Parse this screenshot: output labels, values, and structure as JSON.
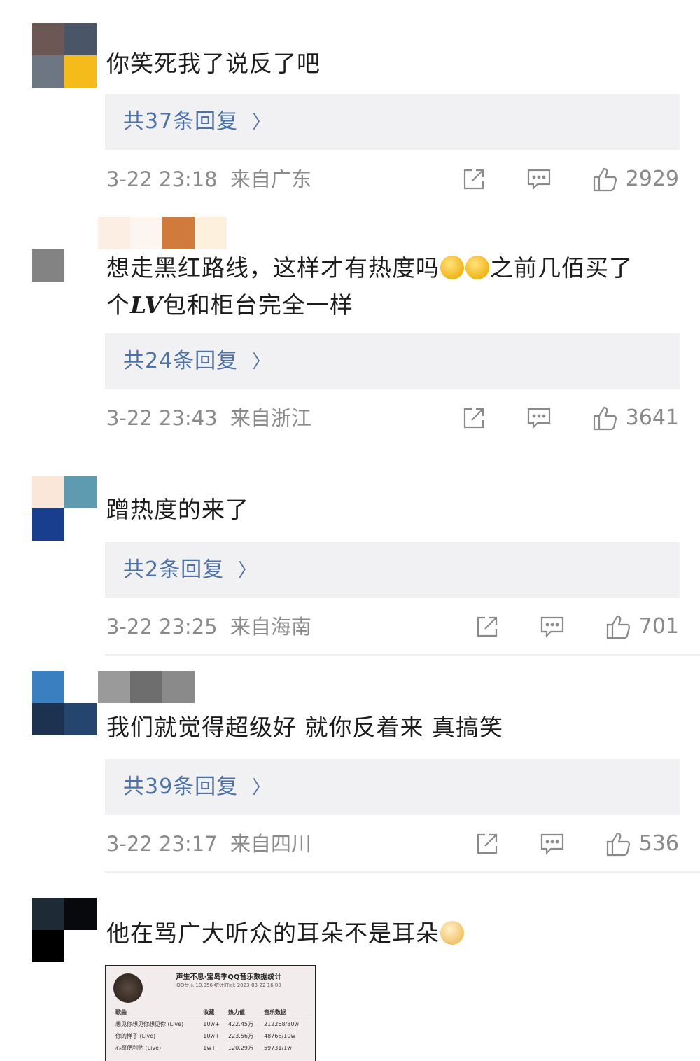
{
  "comments": [
    {
      "text": "你笑死我了说反了吧",
      "replies": "共37条回复",
      "time": "3-22 23:18",
      "location": "来自广东",
      "likes": "2929",
      "avatar_colors": [
        "#6b5855",
        "#4a5668",
        "#6d7683",
        "#f5bb1b"
      ]
    },
    {
      "text_a": "想走黑红路线，这样才有热度吗",
      "text_b": "之前几佰买了",
      "text_c": "个",
      "text_lv": "LV",
      "text_d": "包和柜台完全一样",
      "replies": "共24条回复",
      "time": "3-22 23:43",
      "location": "来自浙江",
      "likes": "3641",
      "avatar_colors": [
        "#838383"
      ]
    },
    {
      "text": "蹭热度的来了",
      "replies": "共2条回复",
      "time": "3-22 23:25",
      "location": "来自海南",
      "likes": "701",
      "avatar_colors": [
        "#fbe7da",
        "#5e9bb0",
        "#173f8e",
        "#ffffff"
      ]
    },
    {
      "text": "我们就觉得超级好  就你反着来  真搞笑",
      "replies": "共39条回复",
      "time": "3-22 23:17",
      "location": "来自四川",
      "likes": "536",
      "avatar_colors": [
        "#3a80c0",
        "#ffffff",
        "#1c3250",
        "#24466e"
      ]
    },
    {
      "text": "他在骂广大听众的耳朵不是耳朵",
      "avatar_colors": [
        "#1e2a36",
        "#07090d",
        "#000000",
        "#ffffff"
      ],
      "attachment": {
        "title": "声生不息·宝岛季QQ音乐数据统计",
        "subtitle": "QQ音乐 10,956   统计时间: 2023-03-22 16:00",
        "headers": [
          "歌曲",
          "收藏",
          "热力值",
          "音乐数据"
        ],
        "rows": [
          [
            "想见你想见你想见你 (Live)",
            "10w+",
            "422.45万",
            "212268/30w"
          ],
          [
            "你的样子 (Live)",
            "10w+",
            "223.56万",
            "48768/10w"
          ],
          [
            "心愿便利贴 (Live)",
            "1w+",
            "120.29万",
            "59731/1w"
          ]
        ]
      }
    }
  ],
  "colors": {
    "reply_link": "#4f72a6",
    "reply_bg": "#f1f1f3",
    "meta_gray": "#8a8a8a"
  },
  "icons": [
    "share-icon",
    "comment-icon",
    "like-icon",
    "chevron-right-icon"
  ]
}
